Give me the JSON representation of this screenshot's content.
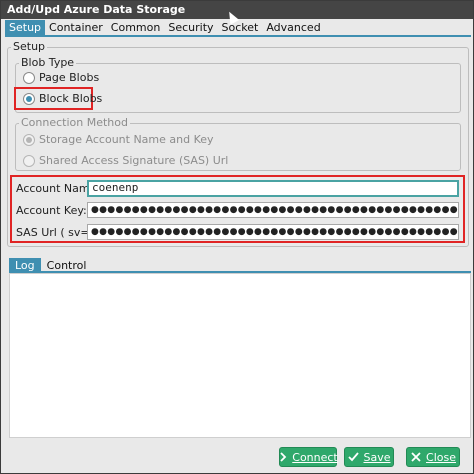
{
  "window": {
    "title": "Add/Upd Azure Data Storage"
  },
  "tabs": [
    {
      "label": "Setup",
      "active": true
    },
    {
      "label": "Container",
      "active": false
    },
    {
      "label": "Common",
      "active": false
    },
    {
      "label": "Security",
      "active": false
    },
    {
      "label": "Socket",
      "active": false
    },
    {
      "label": "Advanced",
      "active": false
    }
  ],
  "setup": {
    "group_label": "Setup",
    "blob_type": {
      "label": "Blob Type",
      "options": [
        {
          "label": "Page Blobs",
          "checked": false
        },
        {
          "label": "Block Blobs",
          "checked": true
        }
      ]
    },
    "connection_method": {
      "label": "Connection Method",
      "options": [
        {
          "label": "Storage Account Name and Key",
          "checked": true
        },
        {
          "label": "Shared Access Signature (SAS) Url",
          "checked": false
        }
      ]
    },
    "fields": {
      "account_name": {
        "label": "Account Name:",
        "value": "coenenp"
      },
      "account_key": {
        "label": "Account Key:",
        "value": "●●●●●●●●●●●●●●●●●●●●●●●●●●●●●●●●●●●●●●●●●●●●●●●●●●●●●●●●●●●●●●●●●●●●●●●●●●"
      },
      "sas_url": {
        "label": "SAS Url ( sv=.. ):",
        "value": "●●●●●●●●●●●●●●●●●●●●●●●●●●●●●●●●●●●●●●●●●●●●●●●●●●●●●●●●●●●●●●●●●●●●●●●●●●"
      }
    }
  },
  "log_tabs": [
    {
      "label": "Log",
      "active": true
    },
    {
      "label": "Control",
      "active": false
    }
  ],
  "buttons": {
    "connect": {
      "label": "Connect",
      "icon": "chevron-right-icon"
    },
    "save": {
      "label": "Save",
      "icon": "check-icon"
    },
    "close": {
      "label": "Close",
      "icon": "close-icon"
    }
  },
  "colors": {
    "accent": "#3f8fb1",
    "button": "#2fa86b",
    "highlight": "#e02424",
    "titlebar": "#454545"
  }
}
